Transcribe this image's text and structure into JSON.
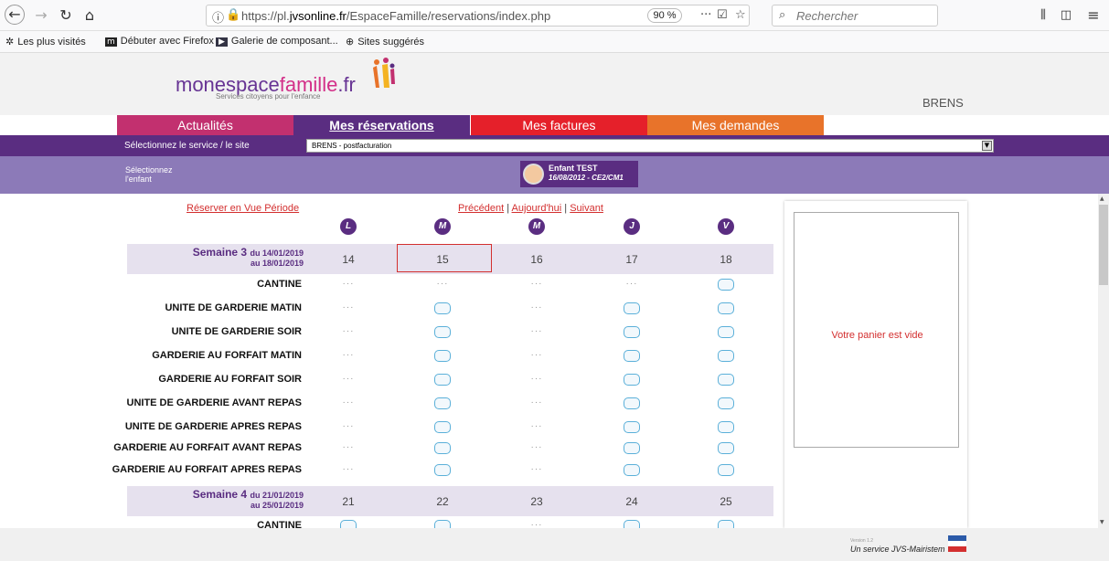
{
  "browser": {
    "url_prefix": "https://pl.",
    "url_domain": "jvsonline.fr",
    "url_path": "/EspaceFamille/reservations/index.php",
    "zoom": "90 %",
    "search_placeholder": "Rechercher",
    "bookmarks": [
      "Les plus visités",
      "Débuter avec Firefox",
      "Galerie de composant...",
      "Sites suggérés"
    ]
  },
  "header": {
    "logo_a": "monespace",
    "logo_b": "famille",
    "logo_c": ".fr",
    "tagline": "Services citoyens pour l'enfance",
    "commune": "BRENS"
  },
  "tabs": [
    {
      "label": "Actualités",
      "color": "#c2306f"
    },
    {
      "label": "Mes réservations",
      "color": "#5a2d81"
    },
    {
      "label": "Mes factures",
      "color": "#e5202a"
    },
    {
      "label": "Mes demandes",
      "color": "#e8732a"
    }
  ],
  "service": {
    "label": "Sélectionnez le service / le site",
    "value": "BRENS - postfacturation"
  },
  "child": {
    "label": "Sélectionnez l'enfant",
    "name": "Enfant TEST",
    "details": "16/08/2012 - CE2/CM1"
  },
  "calendar": {
    "reserve_link": "Réserver en Vue Période",
    "prev": "Précédent",
    "sep": "|",
    "today": "Aujourd'hui",
    "next": "Suivant",
    "days": [
      "L",
      "M",
      "M",
      "J",
      "V"
    ],
    "weeks": [
      {
        "title": "Semaine 3",
        "from": "du 14/01/2019",
        "to": "au 18/01/2019",
        "dates": [
          "14",
          "15",
          "16",
          "17",
          "18"
        ]
      },
      {
        "title": "Semaine 4",
        "from": "du 21/01/2019",
        "to": "au 25/01/2019",
        "dates": [
          "21",
          "22",
          "23",
          "24",
          "25"
        ]
      }
    ],
    "dots_symbol": "···",
    "rows": [
      {
        "label": "CANTINE",
        "cells": [
          "dots",
          "dots",
          "dots",
          "dots",
          "box"
        ]
      },
      {
        "label": "UNITE DE GARDERIE MATIN",
        "cells": [
          "dots",
          "box",
          "dots",
          "box",
          "box"
        ]
      },
      {
        "label": "UNITE DE GARDERIE SOIR",
        "cells": [
          "dots",
          "box",
          "dots",
          "box",
          "box"
        ]
      },
      {
        "label": "GARDERIE AU FORFAIT MATIN",
        "cells": [
          "dots",
          "box",
          "dots",
          "box",
          "box"
        ]
      },
      {
        "label": "GARDERIE AU FORFAIT SOIR",
        "cells": [
          "dots",
          "box",
          "dots",
          "box",
          "box"
        ]
      },
      {
        "label": "UNITE DE GARDERIE AVANT REPAS",
        "cells": [
          "dots",
          "box",
          "dots",
          "box",
          "box"
        ]
      },
      {
        "label": "UNITE DE GARDERIE APRES REPAS",
        "cells": [
          "dots",
          "box",
          "dots",
          "box",
          "box"
        ]
      },
      {
        "label": "GARDERIE AU FORFAIT AVANT REPAS",
        "cells": [
          "dots",
          "box",
          "dots",
          "box",
          "box"
        ]
      },
      {
        "label": "GARDERIE AU FORFAIT APRES REPAS",
        "cells": [
          "dots",
          "box",
          "dots",
          "box",
          "box"
        ]
      }
    ],
    "week4_row": {
      "label": "CANTINE",
      "cells": [
        "box",
        "box",
        "dots",
        "box",
        "box"
      ]
    }
  },
  "cart": {
    "empty_text": "Votre panier est vide"
  },
  "footer": {
    "version": "Version 1.2",
    "service_by": "Un service JVS-Mairistem"
  }
}
